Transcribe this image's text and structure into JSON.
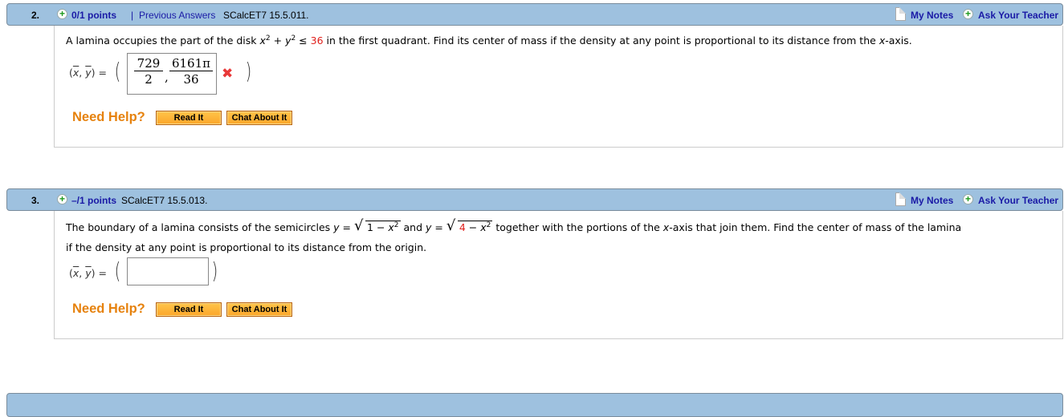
{
  "questions": [
    {
      "number": "2.",
      "points": "0/1 points",
      "separator": "|",
      "previous_answers": "Previous Answers",
      "code": "SCalcET7 15.5.011.",
      "my_notes": "My Notes",
      "ask_teacher": "Ask Your Teacher",
      "text_before": "A lamina occupies the part of the disk ",
      "math_x": "x",
      "math_plus": " + ",
      "math_y": "y",
      "math_exp": "2",
      "math_leq": " ≤ ",
      "math_value": "36",
      "text_after": " in the first quadrant. Find its center of mass if the density at any point is proportional to its distance from the ",
      "text_xaxis_var": "x",
      "text_end": "-axis.",
      "answer_label_x": "x",
      "answer_label_y": "y",
      "answer_label_eq": " =",
      "answer": {
        "x_num": "729",
        "x_den": "2",
        "y_num": "6161π",
        "y_den": "36",
        "status": "incorrect"
      },
      "need_help": "Need Help?",
      "read_it": "Read It",
      "chat_about_it": "Chat About It"
    },
    {
      "number": "3.",
      "points": "–/1 points",
      "code": "SCalcET7 15.5.013.",
      "my_notes": "My Notes",
      "ask_teacher": "Ask Your Teacher",
      "text_1": "The boundary of a lamina consists of the semicircles ",
      "y_eq": "y =",
      "sqrt1": "1 − ",
      "sqrt_x": "x",
      "sqrt_exp": "2",
      "and": " and ",
      "sqrt2_num": "4",
      "sqrt2_rest": " − ",
      "text_2": " together with the portions of the ",
      "xaxis_var": "x",
      "text_3": "-axis that join them. Find the center of mass of the lamina",
      "text_line2": "if the density at any point is proportional to its distance from the origin.",
      "answer_label_x": "x",
      "answer_label_y": "y",
      "answer_label_eq": " =",
      "answer_value": "",
      "need_help": "Need Help?",
      "read_it": "Read It",
      "chat_about_it": "Chat About It"
    }
  ],
  "colors": {
    "header_bg": "#9ec1df",
    "link": "#1a1aa6",
    "help": "#e6820e",
    "incorrect": "#e83838",
    "highlight_value": "#e0201c"
  }
}
